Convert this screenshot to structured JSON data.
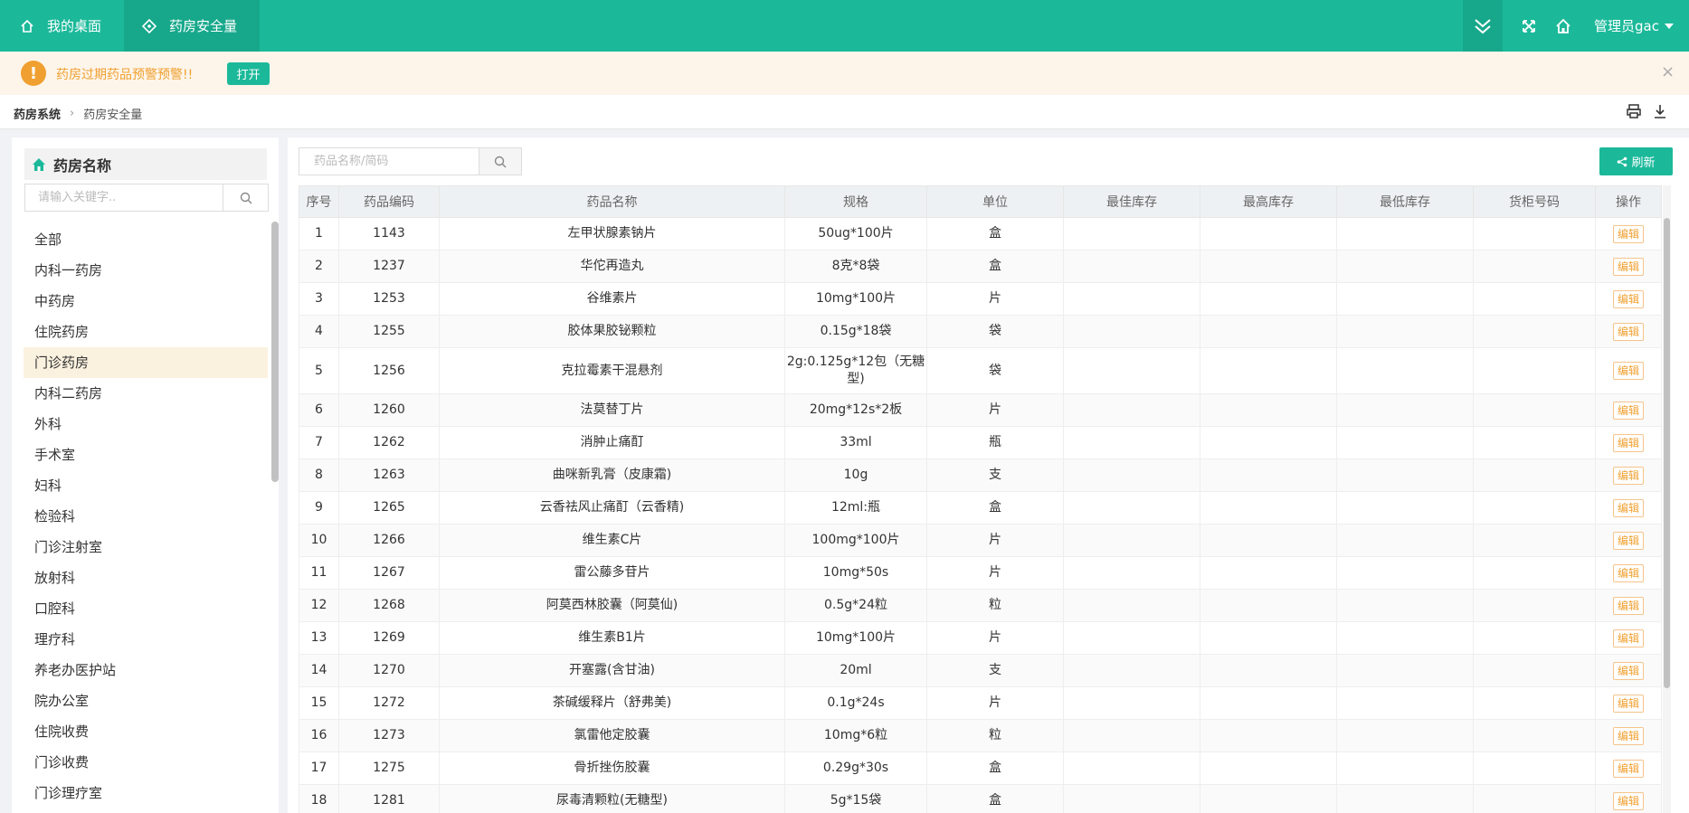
{
  "topnav": {
    "tabs": [
      {
        "label": "我的桌面",
        "icon": "home-icon"
      },
      {
        "label": "药房安全量",
        "icon": "diamond-icon"
      }
    ],
    "user_label": "管理员gac"
  },
  "alert": {
    "icon": "exclamation-icon",
    "text": "药房过期药品预警预警!!",
    "open_label": "打开",
    "close_label": "×"
  },
  "breadcrumb": {
    "root": "药房系统",
    "current": "药房安全量"
  },
  "sidebar": {
    "title": "药房名称",
    "search_placeholder": "请输入关键字..",
    "items": [
      "全部",
      "内科一药房",
      "中药房",
      "住院药房",
      "门诊药房",
      "内科二药房",
      "外科",
      "手术室",
      "妇科",
      "检验科",
      "门诊注射室",
      "放射科",
      "口腔科",
      "理疗科",
      "养老办医护站",
      "院办公室",
      "住院收费",
      "门诊收费",
      "门诊理疗室"
    ],
    "selected_index": 4
  },
  "main": {
    "search_placeholder": "药品名称/简码",
    "refresh_label": "刷新",
    "columns": [
      "序号",
      "药品编码",
      "药品名称",
      "规格",
      "单位",
      "最佳库存",
      "最高库存",
      "最低库存",
      "货柜号码",
      "操作"
    ],
    "edit_label": "编辑",
    "rows": [
      [
        "1",
        "1143",
        "左甲状腺素钠片",
        "50ug*100片",
        "盒"
      ],
      [
        "2",
        "1237",
        "华佗再造丸",
        "8克*8袋",
        "盒"
      ],
      [
        "3",
        "1253",
        "谷维素片",
        "10mg*100片",
        "片"
      ],
      [
        "4",
        "1255",
        "胶体果胶铋颗粒",
        "0.15g*18袋",
        "袋"
      ],
      [
        "5",
        "1256",
        "克拉霉素干混悬剂",
        "2g:0.125g*12包（无糖型)",
        "袋"
      ],
      [
        "6",
        "1260",
        "法莫替丁片",
        "20mg*12s*2板",
        "片"
      ],
      [
        "7",
        "1262",
        "消肿止痛酊",
        "33ml",
        "瓶"
      ],
      [
        "8",
        "1263",
        "曲咪新乳膏（皮康霜)",
        "10g",
        "支"
      ],
      [
        "9",
        "1265",
        "云香祛风止痛酊（云香精)",
        "12ml:瓶",
        "盒"
      ],
      [
        "10",
        "1266",
        "维生素C片",
        "100mg*100片",
        "片"
      ],
      [
        "11",
        "1267",
        "雷公藤多苷片",
        "10mg*50s",
        "片"
      ],
      [
        "12",
        "1268",
        "阿莫西林胶囊（阿莫仙)",
        "0.5g*24粒",
        "粒"
      ],
      [
        "13",
        "1269",
        "维生素B1片",
        "10mg*100片",
        "片"
      ],
      [
        "14",
        "1270",
        "开塞露(含甘油)",
        "20ml",
        "支"
      ],
      [
        "15",
        "1272",
        "茶碱缓释片（舒弗美)",
        "0.1g*24s",
        "片"
      ],
      [
        "16",
        "1273",
        "氯雷他定胶囊",
        "10mg*6粒",
        "粒"
      ],
      [
        "17",
        "1275",
        "骨折挫伤胶囊",
        "0.29g*30s",
        "盒"
      ],
      [
        "18",
        "1281",
        "尿毒清颗粒(无糖型)",
        "5g*15袋",
        "盒"
      ]
    ]
  },
  "colors": {
    "primary": "#1bb99a",
    "primary_dark": "#17a88b",
    "warning": "#f0a030",
    "alert_bg": "#fdf5ea",
    "selected_bg": "#fbf1df"
  }
}
